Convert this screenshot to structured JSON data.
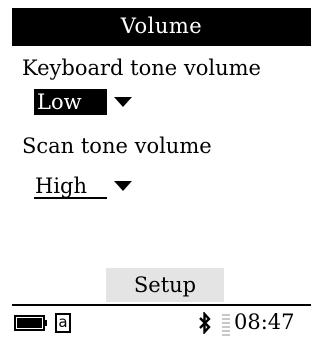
{
  "window": {
    "title": "Volume"
  },
  "settings": {
    "keyboard_tone": {
      "label": "Keyboard tone volume",
      "value": "Low",
      "selected": true
    },
    "scan_tone": {
      "label": "Scan tone volume",
      "value": "High",
      "selected": false
    }
  },
  "buttons": {
    "setup_label": "Setup"
  },
  "status": {
    "input_mode": "a",
    "time": "08:47",
    "icons": [
      "battery-icon",
      "input-mode-icon",
      "bluetooth-icon",
      "signal-icon"
    ]
  },
  "colors": {
    "title_bg": "#000000",
    "button_bg": "#e4e4e4",
    "background": "#ffffff"
  }
}
